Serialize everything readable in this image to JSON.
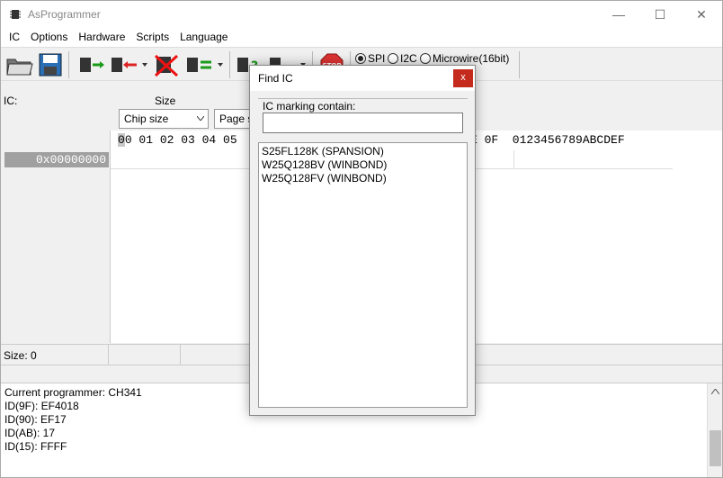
{
  "app": {
    "title": "AsProgrammer"
  },
  "window_controls": {
    "minimize": "—",
    "maximize": "☐",
    "close": "✕"
  },
  "menu": [
    "IC",
    "Options",
    "Hardware",
    "Scripts",
    "Language"
  ],
  "toolbar": {
    "icons": [
      "open-folder-icon",
      "save-icon",
      "read-chip-icon",
      "write-chip-icon",
      "erase-chip-icon",
      "verify-chip-icon",
      "read-id-icon",
      "script-icon",
      "stop-icon"
    ],
    "stop_label": "STOP",
    "protocols": [
      {
        "label": "SPI",
        "selected": true
      },
      {
        "label": "I2C",
        "selected": false
      },
      {
        "label": "Microwire(16bit)",
        "selected": false
      }
    ]
  },
  "params": {
    "ic_label": "IC:",
    "size_label": "Size",
    "page_label": "P",
    "chip_size_value": "Chip size",
    "page_size_value": "Page s"
  },
  "hex": {
    "header_first": "0",
    "header_rest": "0 01 02 03 04 05",
    "header_tail": "E 0F  0123456789ABCDEF",
    "address": "0x00000000"
  },
  "status": {
    "size": "Size: 0"
  },
  "log": [
    "Current programmer: CH341",
    "ID(9F): EF4018",
    "ID(90): EF17",
    "ID(AB): 17",
    "ID(15): FFFF"
  ],
  "dialog": {
    "title": "Find IC",
    "close": "x",
    "label": "IC marking contain:",
    "input_value": "",
    "results": [
      "S25FL128K (SPANSION)",
      "W25Q128BV (WINBOND)",
      "W25Q128FV (WINBOND)"
    ]
  }
}
